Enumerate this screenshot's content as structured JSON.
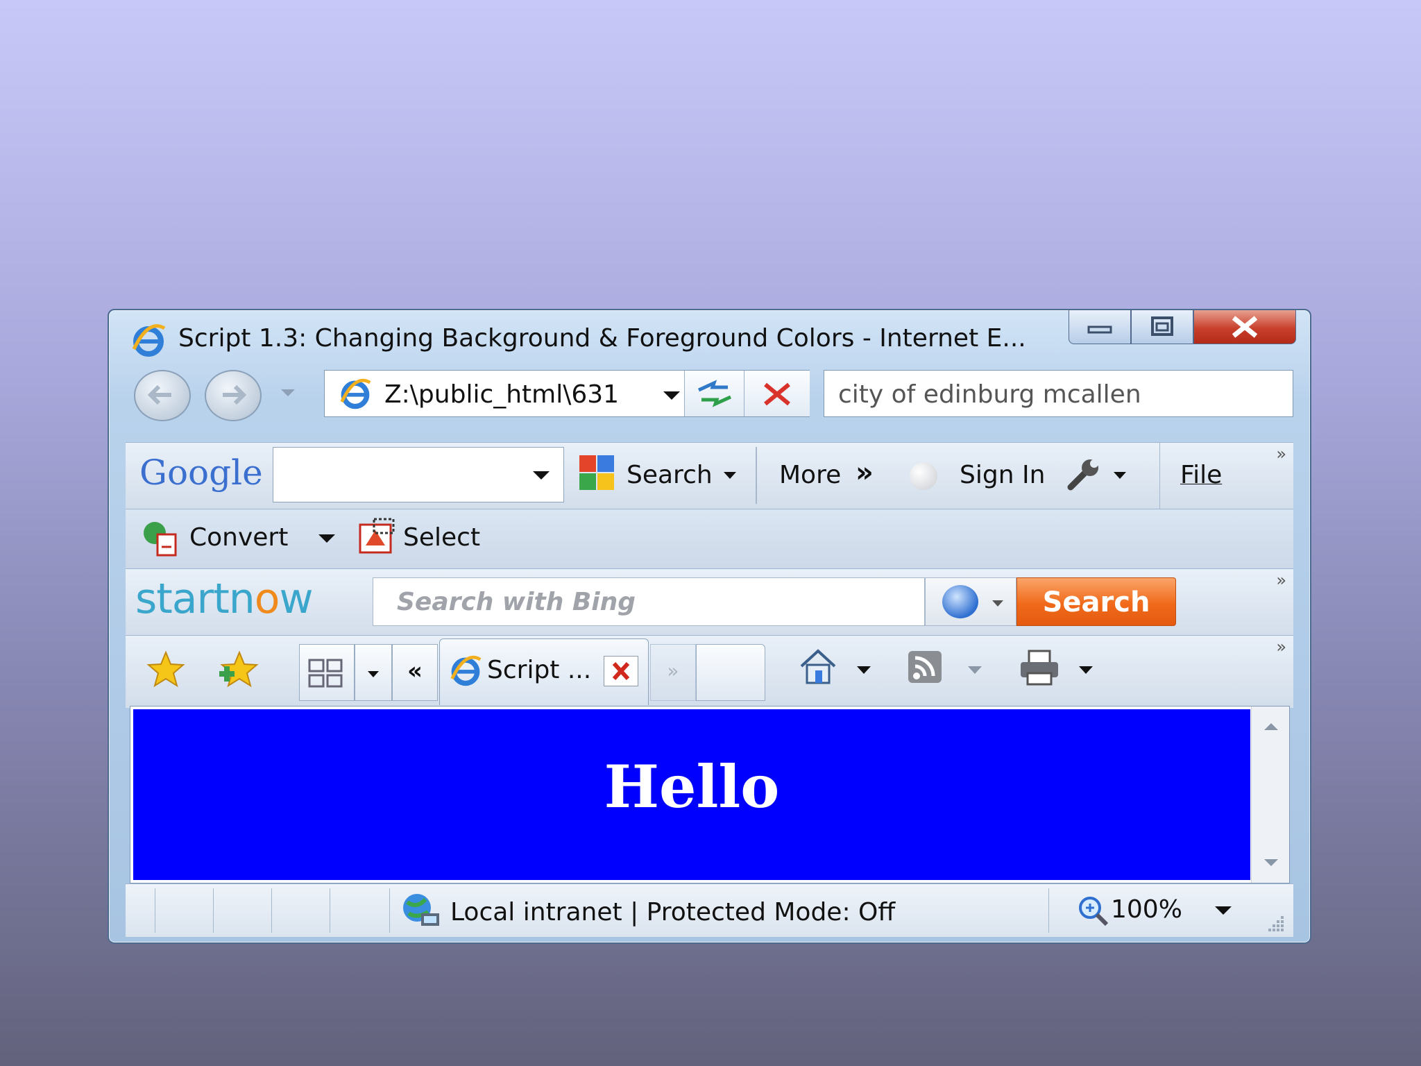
{
  "window": {
    "title": "Script 1.3: Changing Background & Foreground Colors - Internet E..."
  },
  "nav": {
    "address": "Z:\\public_html\\631",
    "search_value": "city of edinburg mcallen"
  },
  "google_toolbar": {
    "logo": "Google",
    "search_label": "Search",
    "more_label": "More",
    "more_chevron": "»",
    "signin_label": "Sign In",
    "file_label": "File"
  },
  "convert_toolbar": {
    "convert_label": "Convert",
    "select_label": "Select"
  },
  "startnow_toolbar": {
    "logo_a": "startn",
    "logo_b": "w",
    "search_placeholder": "Search with Bing",
    "search_button": "Search"
  },
  "fav_toolbar": {
    "back_tabs": "«",
    "tab_label": "Script ...",
    "forward_tabs": "»"
  },
  "content": {
    "heading": "Hello",
    "background_color": "#0000ff",
    "text_color": "#ffffff"
  },
  "status": {
    "zone": "Local intranet | Protected Mode: Off",
    "zoom": "100%"
  },
  "icons": [
    "ie-icon",
    "minimize-icon",
    "maximize-icon",
    "close-icon",
    "back-icon",
    "forward-icon",
    "refresh-icon",
    "stop-icon",
    "google-search-icon",
    "wrench-icon",
    "convert-icon",
    "select-icon",
    "bing-icon",
    "favorites-star-icon",
    "add-favorite-icon",
    "quick-tabs-icon",
    "home-icon",
    "rss-icon",
    "print-icon",
    "globe-icon",
    "zoom-icon"
  ]
}
